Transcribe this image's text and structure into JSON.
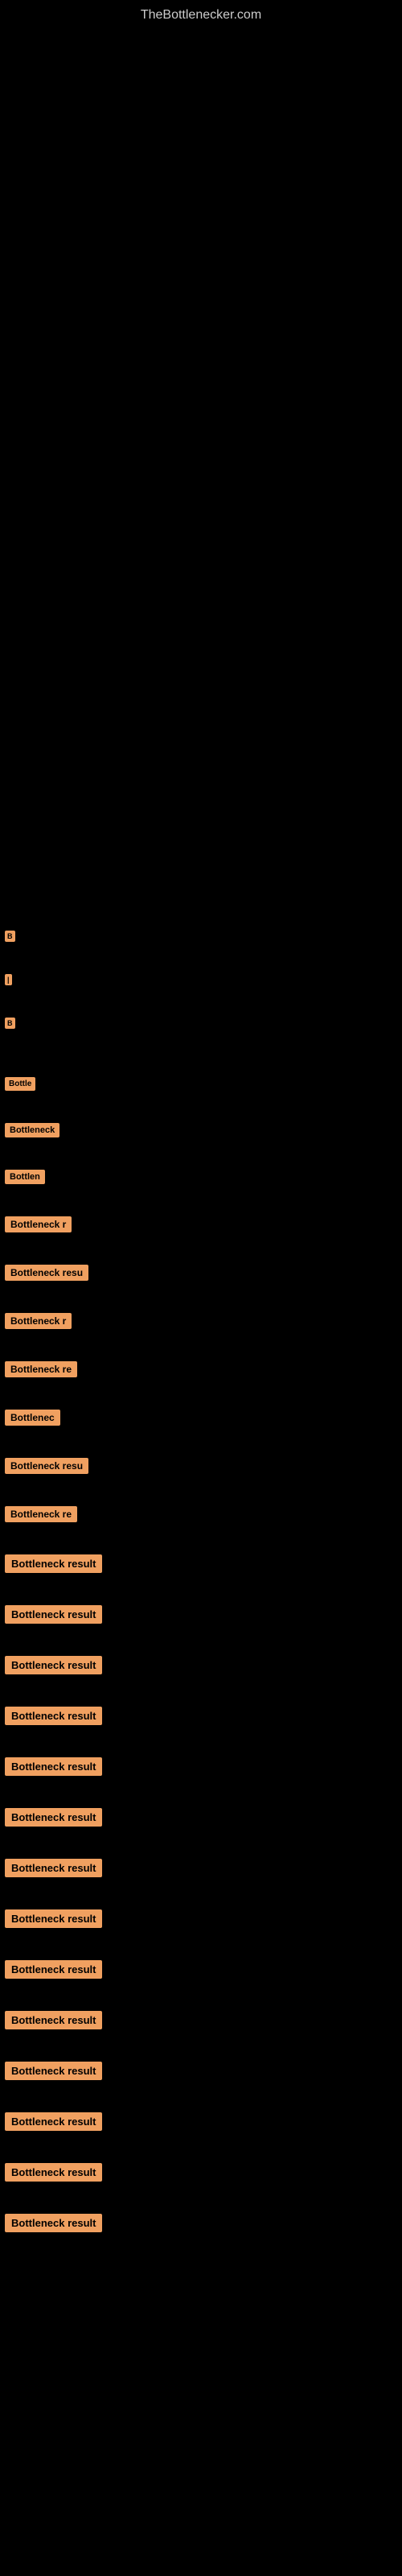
{
  "site": {
    "title": "TheBottlenecker.com"
  },
  "labels": {
    "bottleneck_result": "Bottleneck result"
  },
  "rows": [
    {
      "id": 1,
      "size": "small",
      "text": "B"
    },
    {
      "id": 2,
      "size": "small",
      "text": "|"
    },
    {
      "id": 3,
      "size": "small",
      "text": "B"
    },
    {
      "id": 4,
      "size": "small2",
      "text": "Bottle"
    },
    {
      "id": 5,
      "size": "medium",
      "text": "Bottleneck"
    },
    {
      "id": 6,
      "size": "medium",
      "text": "Bottlen"
    },
    {
      "id": 7,
      "size": "medium2",
      "text": "Bottleneck r"
    },
    {
      "id": 8,
      "size": "medium3",
      "text": "Bottleneck resu"
    },
    {
      "id": 9,
      "size": "medium2",
      "text": "Bottleneck r"
    },
    {
      "id": 10,
      "size": "medium3b",
      "text": "Bottleneck re"
    },
    {
      "id": 11,
      "size": "medium",
      "text": "Bottlenec"
    },
    {
      "id": 12,
      "size": "medium3",
      "text": "Bottleneck resu"
    },
    {
      "id": 13,
      "size": "medium2",
      "text": "Bottleneck re"
    },
    {
      "id": 14,
      "size": "large",
      "text": "Bottleneck result"
    },
    {
      "id": 15,
      "size": "large",
      "text": "Bottleneck result"
    },
    {
      "id": 16,
      "size": "large",
      "text": "Bottleneck result"
    },
    {
      "id": 17,
      "size": "large",
      "text": "Bottleneck result"
    },
    {
      "id": 18,
      "size": "large",
      "text": "Bottleneck result"
    },
    {
      "id": 19,
      "size": "large",
      "text": "Bottleneck result"
    },
    {
      "id": 20,
      "size": "large",
      "text": "Bottleneck result"
    },
    {
      "id": 21,
      "size": "large",
      "text": "Bottleneck result"
    },
    {
      "id": 22,
      "size": "large",
      "text": "Bottleneck result"
    },
    {
      "id": 23,
      "size": "large",
      "text": "Bottleneck result"
    },
    {
      "id": 24,
      "size": "large",
      "text": "Bottleneck result"
    },
    {
      "id": 25,
      "size": "large",
      "text": "Bottleneck result"
    },
    {
      "id": 26,
      "size": "large",
      "text": "Bottleneck result"
    },
    {
      "id": 27,
      "size": "large",
      "text": "Bottleneck result"
    }
  ]
}
